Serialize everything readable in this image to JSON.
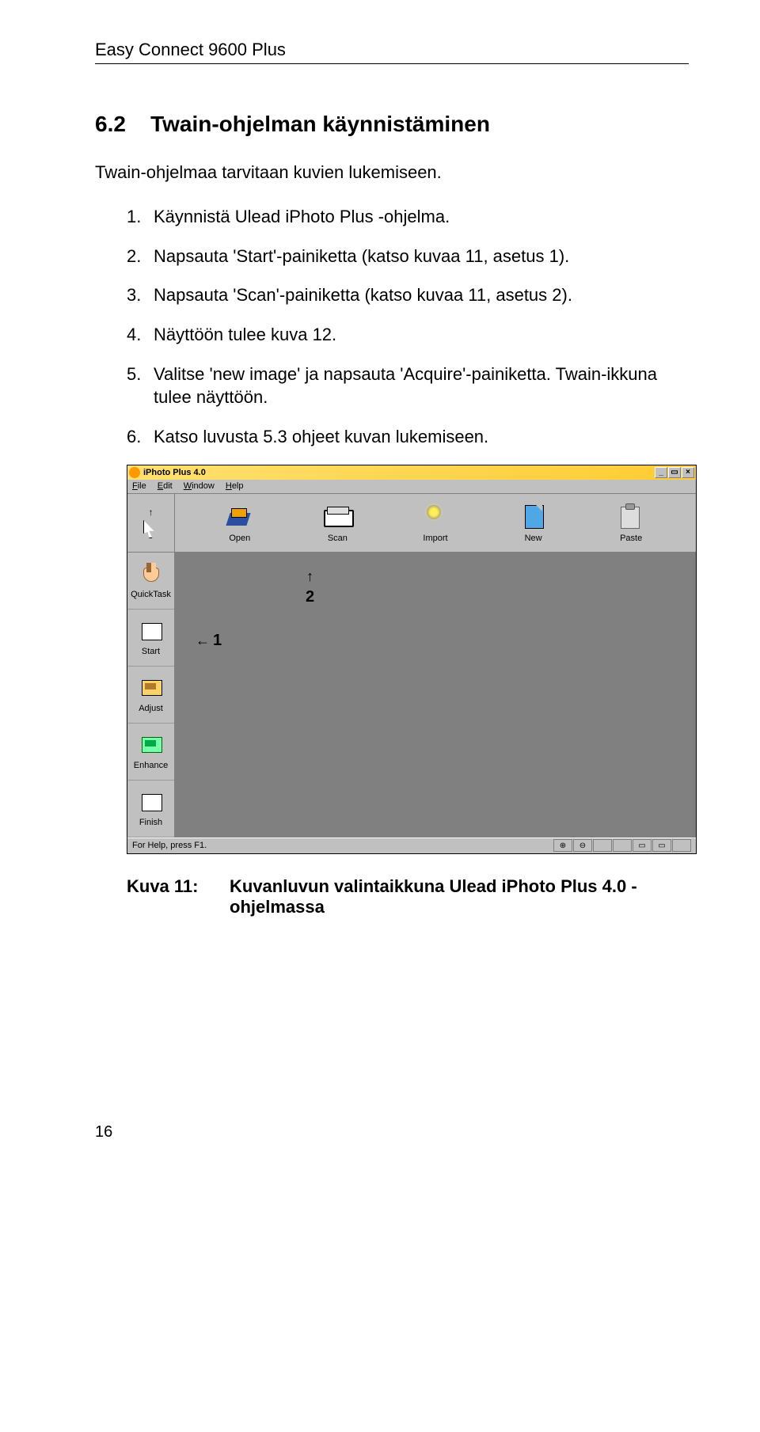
{
  "header": {
    "title": "Easy Connect 9600 Plus"
  },
  "section": {
    "number": "6.2",
    "title": "Twain-ohjelman käynnistäminen",
    "intro": "Twain-ohjelmaa tarvitaan kuvien lukemiseen.",
    "steps": [
      {
        "num": "1.",
        "text": "Käynnistä Ulead iPhoto Plus -ohjelma."
      },
      {
        "num": "2.",
        "text": "Napsauta 'Start'-painiketta (katso kuvaa 11, asetus 1)."
      },
      {
        "num": "3.",
        "text": "Napsauta 'Scan'-painiketta (katso kuvaa 11, asetus 2)."
      },
      {
        "num": "4.",
        "text": "Näyttöön tulee kuva 12."
      },
      {
        "num": "5.",
        "text": "Valitse 'new image' ja napsauta 'Acquire'-painiketta. Twain-ikkuna tulee näyttöön."
      },
      {
        "num": "6.",
        "text": "Katso luvusta 5.3 ohjeet kuvan lukemiseen."
      }
    ]
  },
  "screenshot": {
    "title": "iPhoto Plus 4.0",
    "menus": {
      "file": "File",
      "edit": "Edit",
      "window": "Window",
      "help": "Help"
    },
    "winbtns": {
      "min": "_",
      "max": "▭",
      "close": "×"
    },
    "toolbar": [
      {
        "label": "Open"
      },
      {
        "label": "Scan"
      },
      {
        "label": "Import"
      },
      {
        "label": "New"
      },
      {
        "label": "Paste"
      }
    ],
    "sidebar": [
      {
        "label": "QuickTask"
      },
      {
        "label": "Start"
      },
      {
        "label": "Adjust"
      },
      {
        "label": "Enhance"
      },
      {
        "label": "Finish"
      }
    ],
    "annotations": {
      "one": "1",
      "two": "2"
    },
    "statusbar": {
      "left": "For Help, press F1.",
      "cells": [
        "⊕",
        "⊖",
        " ",
        " ",
        "▭",
        "▭",
        " "
      ]
    }
  },
  "caption": {
    "label": "Kuva 11:",
    "text": "Kuvanluvun valintaikkuna Ulead iPhoto Plus 4.0 -ohjelmassa"
  },
  "page_number": "16"
}
